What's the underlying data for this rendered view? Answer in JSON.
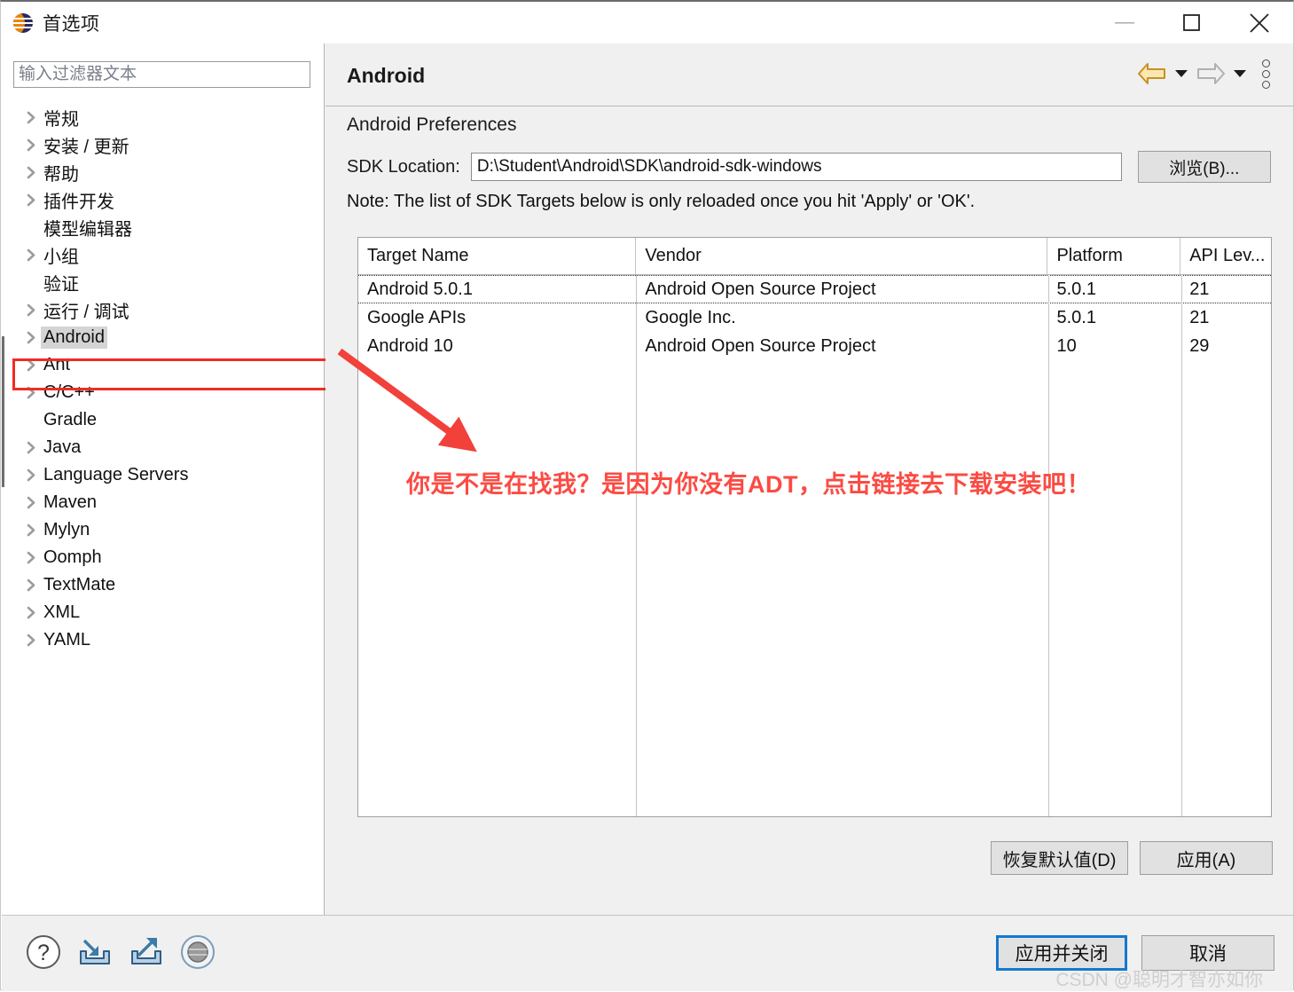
{
  "window": {
    "title": "首选项",
    "app_icon": "eclipse-icon",
    "controls": {
      "minimize": "minimize-icon",
      "maximize": "maximize-icon",
      "close": "close-icon"
    }
  },
  "sidebar": {
    "filter": {
      "value": "",
      "placeholder": "输入过滤器文本"
    },
    "items": [
      {
        "label": "常规",
        "expandable": true,
        "selected": false
      },
      {
        "label": "安装 / 更新",
        "expandable": true,
        "selected": false
      },
      {
        "label": "帮助",
        "expandable": true,
        "selected": false
      },
      {
        "label": "插件开发",
        "expandable": true,
        "selected": false
      },
      {
        "label": "模型编辑器",
        "expandable": false,
        "selected": false
      },
      {
        "label": "小组",
        "expandable": true,
        "selected": false
      },
      {
        "label": "验证",
        "expandable": false,
        "selected": false
      },
      {
        "label": "运行 / 调试",
        "expandable": true,
        "selected": false
      },
      {
        "label": "Android",
        "expandable": true,
        "selected": true
      },
      {
        "label": "Ant",
        "expandable": true,
        "selected": false
      },
      {
        "label": "C/C++",
        "expandable": true,
        "selected": false
      },
      {
        "label": "Gradle",
        "expandable": false,
        "selected": false
      },
      {
        "label": "Java",
        "expandable": true,
        "selected": false
      },
      {
        "label": "Language Servers",
        "expandable": true,
        "selected": false
      },
      {
        "label": "Maven",
        "expandable": true,
        "selected": false
      },
      {
        "label": "Mylyn",
        "expandable": true,
        "selected": false
      },
      {
        "label": "Oomph",
        "expandable": true,
        "selected": false
      },
      {
        "label": "TextMate",
        "expandable": true,
        "selected": false
      },
      {
        "label": "XML",
        "expandable": true,
        "selected": false
      },
      {
        "label": "YAML",
        "expandable": true,
        "selected": false
      }
    ]
  },
  "panel": {
    "title": "Android",
    "nav": {
      "back_icon": "back-arrow-icon",
      "back_caret_icon": "chevron-down-icon",
      "forward_icon": "forward-arrow-icon",
      "forward_caret_icon": "chevron-down-icon",
      "menu_icon": "vertical-dots-menu-icon"
    },
    "section_title": "Android Preferences",
    "sdk_location_label": "SDK Location:",
    "sdk_location_value": "D:\\Student\\Android\\SDK\\android-sdk-windows",
    "browse_button": "浏览(B)...",
    "note": "Note: The list of SDK Targets below is only reloaded once you hit 'Apply' or 'OK'.",
    "buttons": {
      "restore_defaults": "恢复默认值(D)",
      "apply": "应用(A)"
    }
  },
  "table": {
    "columns": [
      "Target Name",
      "Vendor",
      "Platform",
      "API Lev..."
    ],
    "rows": [
      {
        "target_name": "Android 5.0.1",
        "vendor": "Android Open Source Project",
        "platform": "5.0.1",
        "api_level": "21",
        "focused": true
      },
      {
        "target_name": "Google APIs",
        "vendor": "Google Inc.",
        "platform": "5.0.1",
        "api_level": "21",
        "focused": false
      },
      {
        "target_name": "Android 10",
        "vendor": "Android Open Source Project",
        "platform": "10",
        "api_level": "29",
        "focused": false
      }
    ]
  },
  "annotation": {
    "text": "你是不是在找我？是因为你没有ADT，点击链接去下载安装吧！",
    "color": "#fb4b43",
    "highlight_target": "Android"
  },
  "footer": {
    "icons": [
      {
        "name": "help-icon",
        "title": "?"
      },
      {
        "name": "import-preferences-icon",
        "title": ""
      },
      {
        "name": "export-preferences-icon",
        "title": ""
      },
      {
        "name": "sphere-icon",
        "title": ""
      }
    ],
    "buttons": {
      "apply_and_close": "应用并关闭",
      "cancel": "取消"
    },
    "watermark": "CSDN @聪明才智亦如你"
  },
  "colors": {
    "accent_blue": "#1479d0",
    "annotation_red": "#fb4b43",
    "highlight_red": "#ee2e24",
    "panel_bg": "#f0f0f0",
    "back_arrow_gold": "#c8921e"
  }
}
